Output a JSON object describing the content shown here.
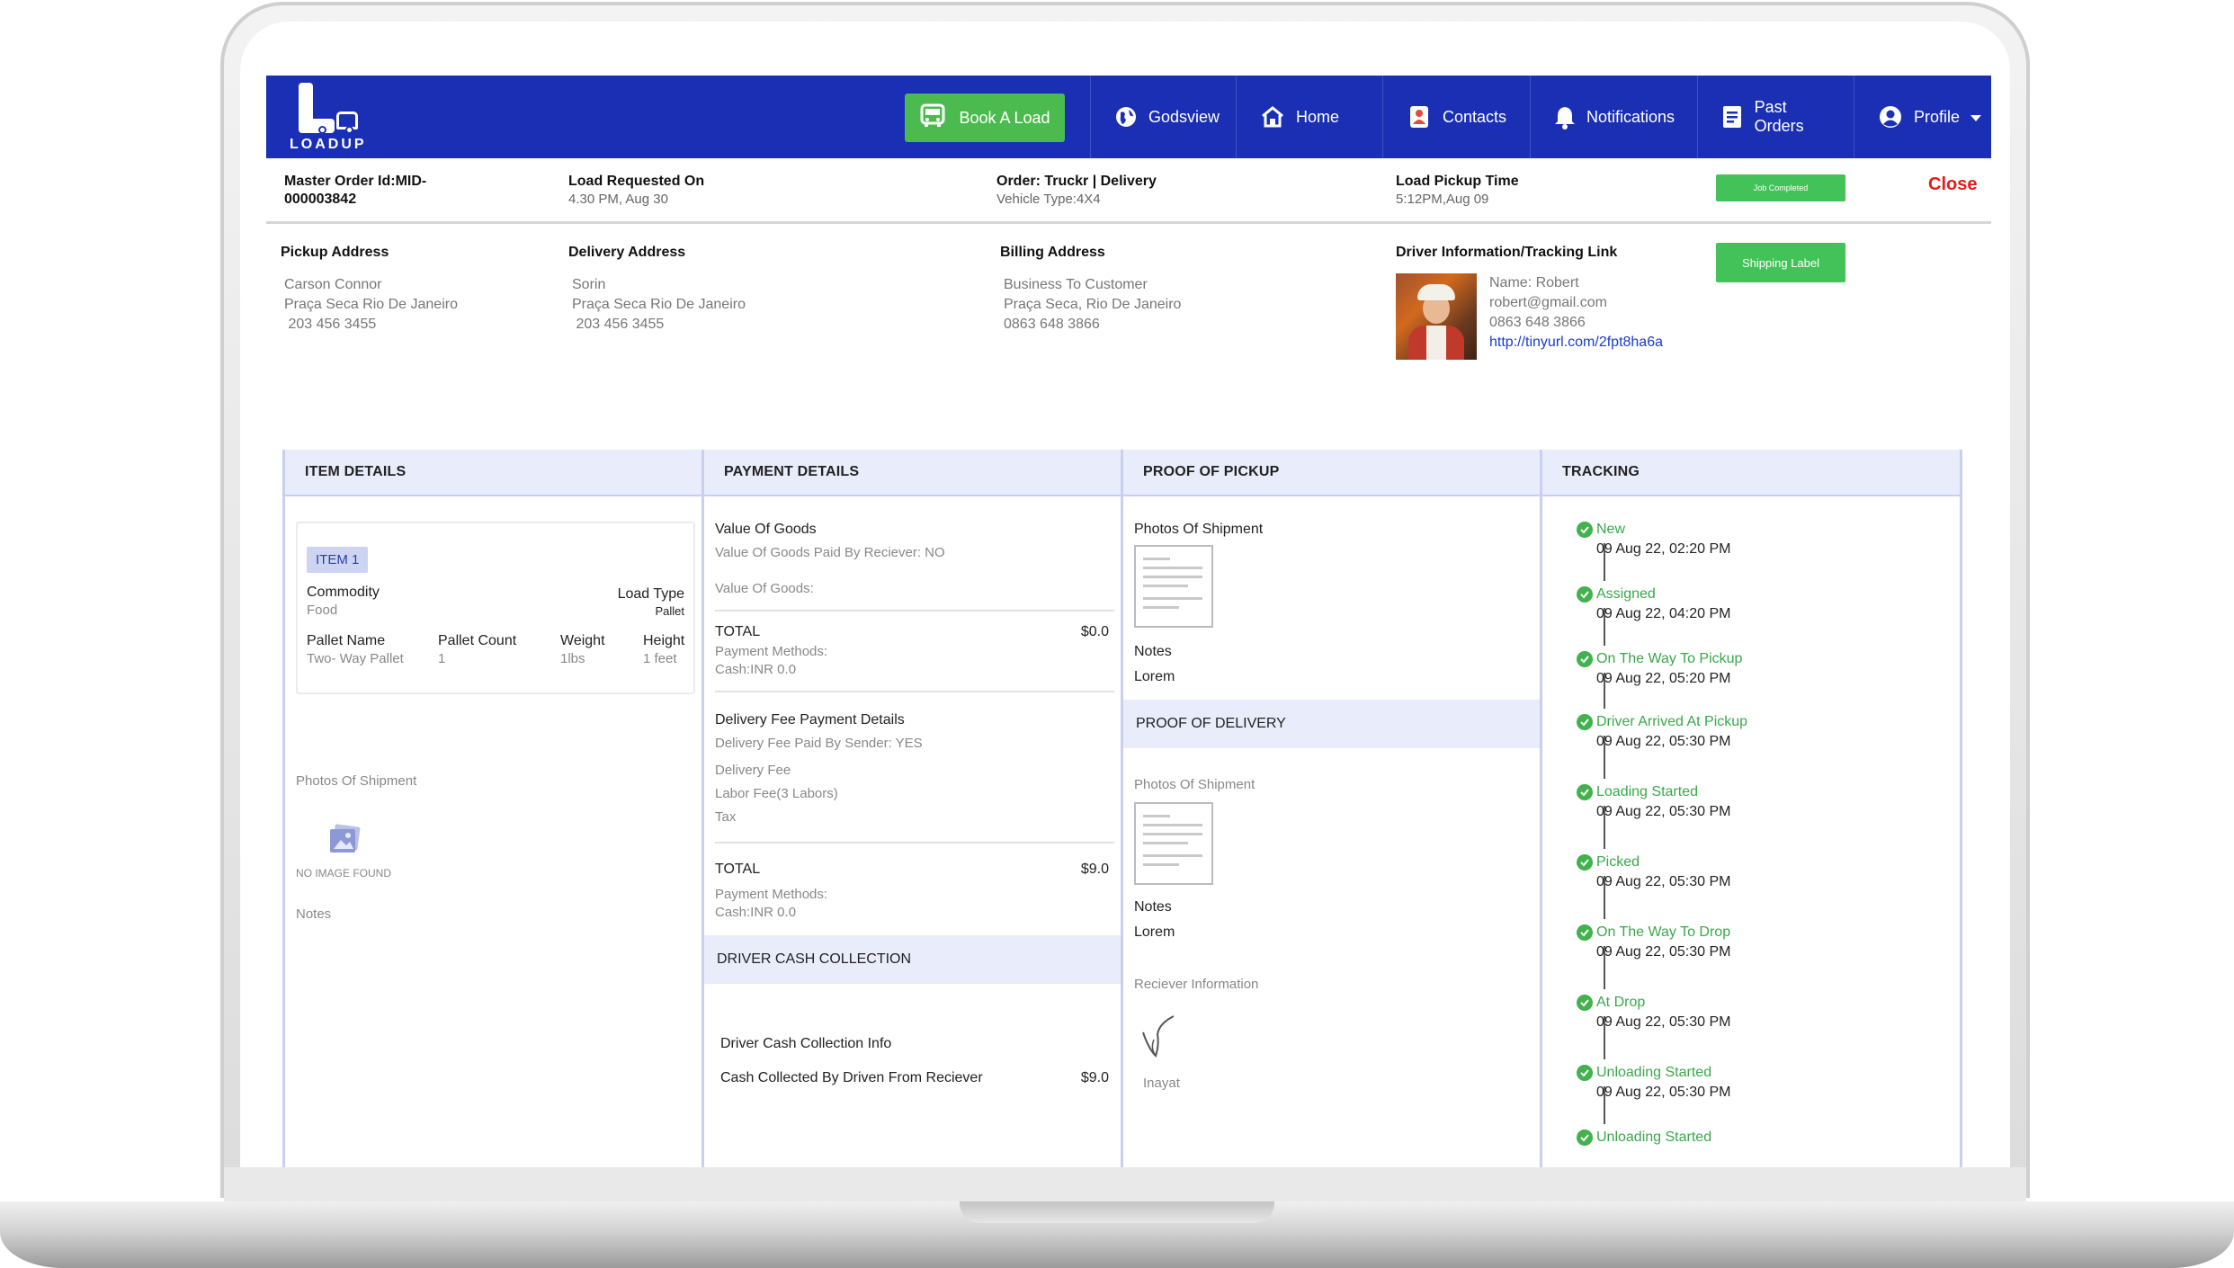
{
  "nav": {
    "logo_text": "LOADUP",
    "book_label": "Book A Load",
    "items": [
      {
        "label": "Godsview",
        "icon": "globe-icon"
      },
      {
        "label": "Home",
        "icon": "home-icon"
      },
      {
        "label": "Contacts",
        "icon": "contacts-icon"
      },
      {
        "label": "Notifications",
        "icon": "bell-icon"
      },
      {
        "label": "Past Orders",
        "icon": "document-icon"
      },
      {
        "label": "Profile",
        "icon": "user-icon"
      }
    ]
  },
  "order": {
    "master_title": "Master Order Id:MID-",
    "master_id": "000003842",
    "requested_title": "Load Requested On",
    "requested_value": "4.30 PM, Aug 30",
    "order_title": "Order: Truckr | Delivery",
    "vehicle": "Vehicle Type:4X4",
    "pickup_time_title": "Load Pickup Time",
    "pickup_time_value": "5:12PM,Aug 09",
    "status_badge": "Job Completed",
    "close_label": "Close",
    "shipping_label": "Shipping Label"
  },
  "addresses": {
    "pickup": {
      "title": "Pickup Address",
      "name": "Carson Connor",
      "line": "Praça Seca Rio De Janeiro",
      "phone": " 203 456 3455"
    },
    "delivery": {
      "title": "Delivery Address",
      "name": "Sorin",
      "line": "Praça Seca Rio De Janeiro",
      "phone": " 203 456 3455"
    },
    "billing": {
      "title": "Billing Address",
      "name": "Business To Customer",
      "line": "Praça Seca, Rio De Janeiro",
      "phone": "0863 648 3866"
    },
    "driver": {
      "title": "Driver Information/Tracking Link",
      "name": "Name: Robert",
      "email": "robert@gmail.com",
      "phone": "0863 648 3866",
      "link": "http://tinyurl.com/2fpt8ha6a"
    }
  },
  "items_panel": {
    "title": "ITEM  DETAILS",
    "badge": "ITEM 1",
    "commodity_label": "Commodity",
    "commodity_value": "Food",
    "load_type_label": "Load Type",
    "load_type_value": "Pallet",
    "pallet_name_label": "Pallet Name",
    "pallet_name_value": "Two- Way Pallet",
    "pallet_count_label": "Pallet Count",
    "pallet_count_value": "1",
    "weight_label": "Weight",
    "weight_value": "1lbs",
    "height_label": "Height",
    "height_value": "1 feet",
    "photos_label": "Photos Of Shipment",
    "no_image": "NO IMAGE FOUND",
    "notes_label": "Notes"
  },
  "payment_panel": {
    "title": "PAYMENT DETAILS",
    "value_of_goods": "Value Of Goods",
    "paid_by_receiver": "Value Of Goods Paid By Reciever: NO",
    "value_of_goods_colon": "Value Of Goods:",
    "total_label": "TOTAL",
    "total1": "$0.0",
    "methods_label": "Payment Methods:",
    "methods_value": "Cash:INR 0.0",
    "delivery_fee_title": "Delivery Fee Payment Details",
    "paid_by_sender": "Delivery Fee Paid By Sender: YES",
    "delivery_fee": "Delivery Fee",
    "labor_fee": "Labor Fee(3 Labors)",
    "tax": "Tax",
    "total2": "$9.0",
    "cash_collection_title": "DRIVER CASH COLLECTION",
    "cash_info": "Driver Cash Collection Info",
    "cash_collected": "Cash Collected By Driven From Reciever",
    "cash_collected_value": "$9.0"
  },
  "proof_panel": {
    "title": "PROOF OF PICKUP",
    "photos_label": "Photos Of Shipment",
    "notes_label": "Notes",
    "notes_value": "Lorem",
    "delivery_title": "PROOF OF DELIVERY",
    "delivery_photos_label": "Photos Of Shipment",
    "delivery_notes_label": "Notes",
    "delivery_notes_value": "Lorem",
    "receiver_info": "Reciever Information",
    "receiver_name": "Inayat"
  },
  "tracking_panel": {
    "title": "TRACKING",
    "steps": [
      {
        "status": "New",
        "time": "09 Aug 22, 02:20 PM"
      },
      {
        "status": "Assigned",
        "time": "09 Aug 22, 04:20 PM"
      },
      {
        "status": "On The Way To Pickup",
        "time": "09 Aug 22, 05:20 PM"
      },
      {
        "status": "Driver Arrived At Pickup",
        "time": "09 Aug 22, 05:30 PM"
      },
      {
        "status": "Loading Started",
        "time": "09 Aug 22, 05:30 PM"
      },
      {
        "status": "Picked",
        "time": "09 Aug 22, 05:30 PM"
      },
      {
        "status": "On The Way To Drop",
        "time": "09 Aug 22, 05:30 PM"
      },
      {
        "status": "At Drop",
        "time": "09 Aug 22, 05:30 PM"
      },
      {
        "status": "Unloading Started",
        "time": "09 Aug 22, 05:30 PM"
      },
      {
        "status": "Unloading Started",
        "time": ""
      }
    ]
  },
  "colors": {
    "nav_blue": "#1a2fb4",
    "green": "#44c25a",
    "close_red": "#e31c1c",
    "panel_head": "#e9ecfa",
    "link_blue": "#1a3ccc"
  }
}
